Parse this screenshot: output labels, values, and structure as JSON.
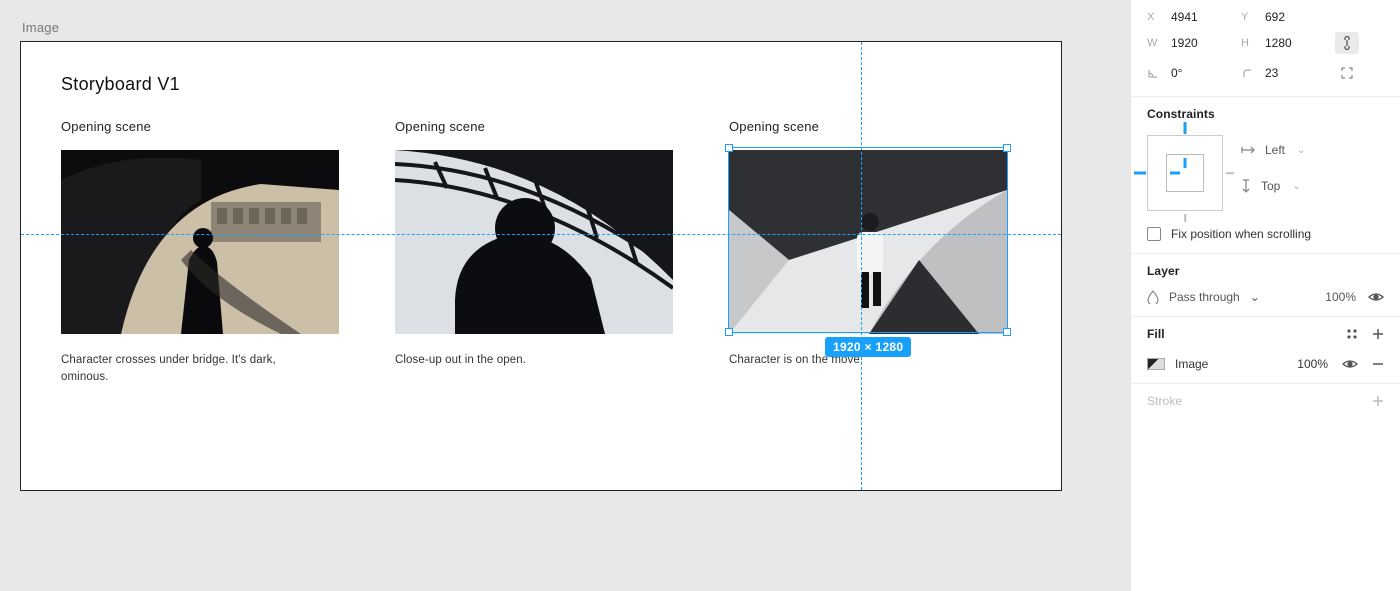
{
  "frame": {
    "label": "Image",
    "title": "Storyboard V1",
    "selected_dim_badge": "1920 × 1280",
    "scenes": [
      {
        "title": "Opening scene",
        "caption": "Character crosses under bridge. It's dark, ominous."
      },
      {
        "title": "Opening scene",
        "caption": "Close-up out in the open."
      },
      {
        "title": "Opening scene",
        "caption": "Character is on the move."
      }
    ]
  },
  "inspector": {
    "position": {
      "x_label": "X",
      "x": "4941",
      "y_label": "Y",
      "y": "692",
      "w_label": "W",
      "w": "1920",
      "h_label": "H",
      "h": "1280",
      "rot_icon": "angle-icon",
      "rot": "0°",
      "radius_icon": "corner-icon",
      "radius": "23"
    },
    "constraints": {
      "title": "Constraints",
      "horizontal": "Left",
      "vertical": "Top",
      "fix_label": "Fix position when scrolling",
      "fixed": false
    },
    "layer": {
      "title": "Layer",
      "blend": "Pass through",
      "opacity": "100%"
    },
    "fill": {
      "title": "Fill",
      "type": "Image",
      "opacity": "100%"
    },
    "stroke": {
      "title": "Stroke"
    }
  }
}
